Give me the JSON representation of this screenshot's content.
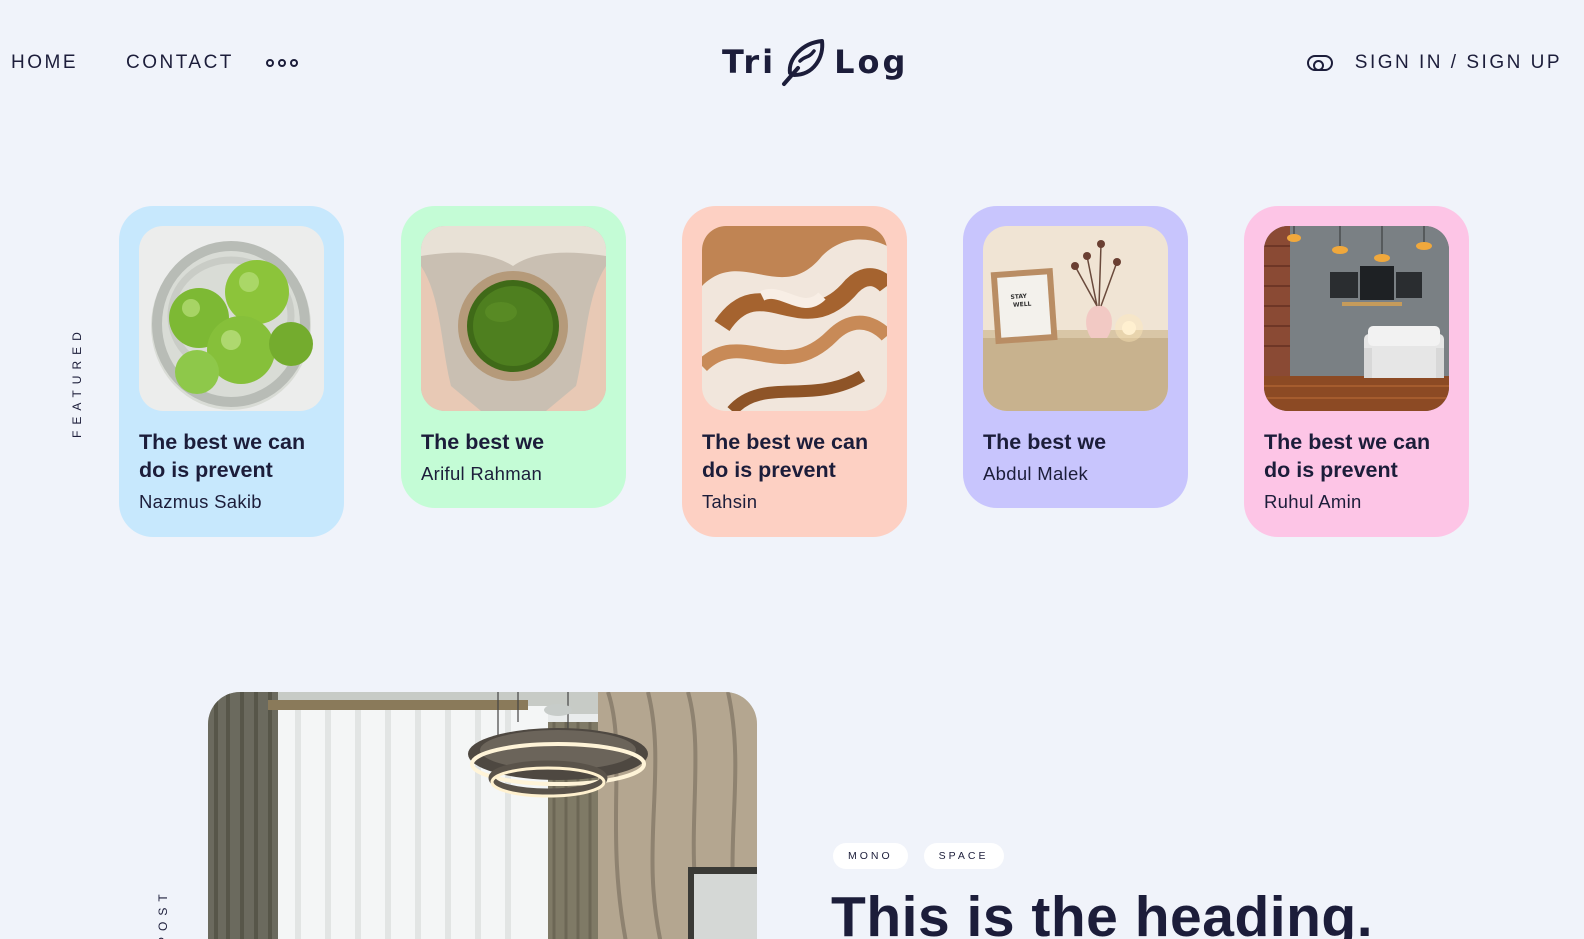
{
  "header": {
    "nav": [
      {
        "label": "HOME"
      },
      {
        "label": "CONTACT"
      }
    ],
    "more_icon": "more-dots-icon",
    "logo": {
      "left": "Tri",
      "right": "Log",
      "icon": "feather-icon"
    },
    "theme_toggle_icon": "toggle-icon",
    "auth_label": "SIGN IN / SIGN UP"
  },
  "featured": {
    "label": "FEATURED",
    "cards": [
      {
        "title": "The best we can do is prevent",
        "author": "Nazmus Sakib",
        "bg": "#c7e8fd",
        "image": "apples-in-jar"
      },
      {
        "title": "The best we",
        "author": "Ariful Rahman",
        "bg": "#c4fcd6",
        "image": "green-tea-cup"
      },
      {
        "title": "The best we can do is prevent",
        "author": "Tahsin",
        "bg": "#fdd0c3",
        "image": "latte-art"
      },
      {
        "title": "The best we",
        "author": "Abdul Malek",
        "bg": "#c8c5fd",
        "image": "letterboard-vase"
      },
      {
        "title": "The best we can do is prevent",
        "author": "Ruhul Amin",
        "bg": "#fdc5e6",
        "image": "living-room"
      }
    ]
  },
  "post": {
    "label": "POST",
    "image": "interior-chandelier",
    "tags": [
      "MONO",
      "SPACE"
    ],
    "heading": "This is the heading."
  }
}
